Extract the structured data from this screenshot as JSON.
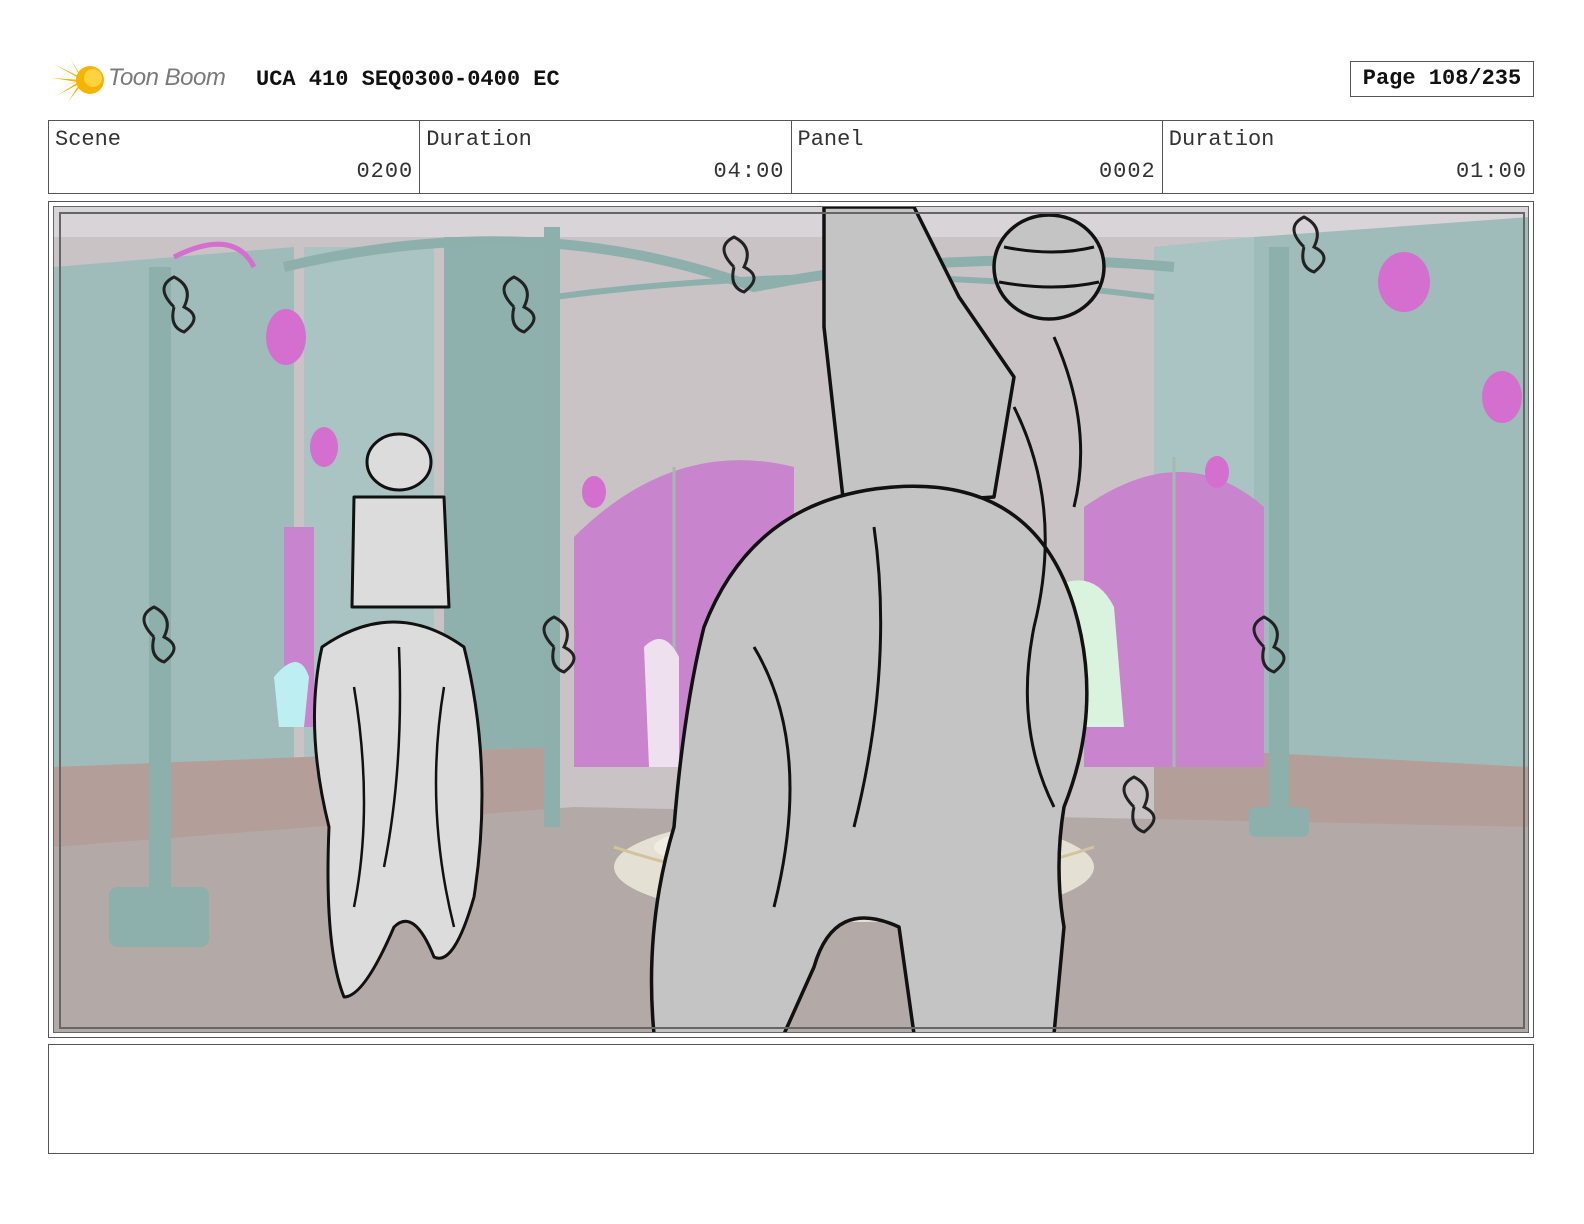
{
  "header": {
    "logo_text": "Toon Boom",
    "project_title": "UCA 410 SEQ0300-0400 EC",
    "page_label": "Page 108/235"
  },
  "info": [
    {
      "label": "Scene",
      "value": "0200"
    },
    {
      "label": "Duration",
      "value": "04:00"
    },
    {
      "label": "Panel",
      "value": "0002"
    },
    {
      "label": "Duration",
      "value": "01:00"
    }
  ],
  "colors": {
    "logo_yellow": "#f5b400",
    "wall_teal": "#9fbcba",
    "window_magenta": "#c884cc",
    "lamp_pink": "#d46fcf",
    "floor_taupe": "#b3aaa8",
    "sketch_gray": "#c4c4c4"
  },
  "notes": {
    "text": ""
  }
}
